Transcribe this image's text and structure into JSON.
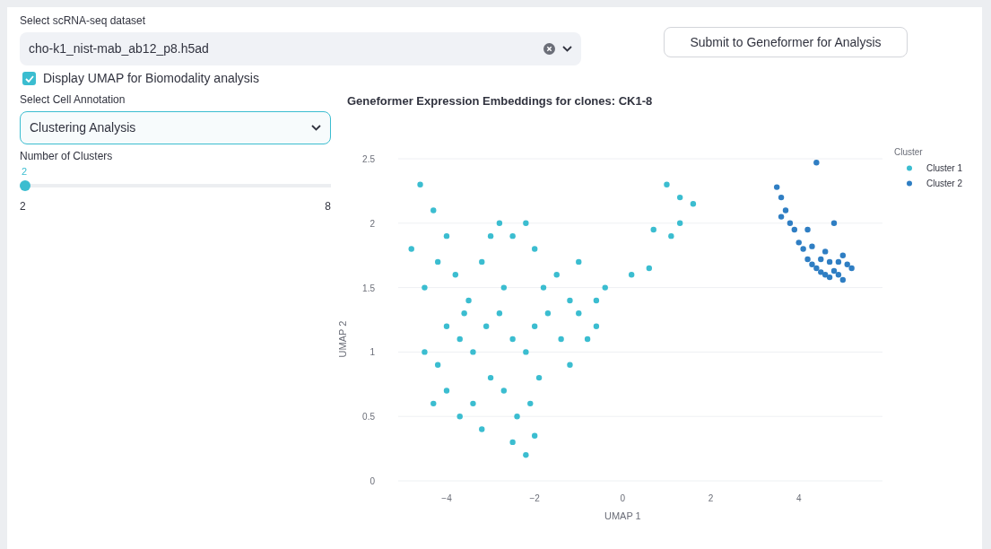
{
  "dataset": {
    "label": "Select scRNA-seq dataset",
    "value": "cho-k1_nist-mab_ab12_p8.h5ad"
  },
  "submit_button": "Submit to Geneformer for Analysis",
  "umap_checkbox": {
    "label": "Display UMAP for Biomodality analysis",
    "checked": true
  },
  "annotation": {
    "label": "Select Cell Annotation",
    "value": "Clustering Analysis"
  },
  "clusters_slider": {
    "label": "Number of Clusters",
    "reading": "2",
    "min_label": "2",
    "max_label": "8",
    "level": 0
  },
  "chart": {
    "chart_data": {
      "type": "scatter",
      "title": "Geneformer Expression Embeddings for clones:  CK1-8",
      "xlabel": "UMAP 1",
      "ylabel": "UMAP 2",
      "legend": {
        "title": "Cluster"
      },
      "grid": true,
      "xlim": [
        -5.1,
        5.9
      ],
      "ylim": [
        0,
        2.5
      ],
      "xticks": [
        {
          "value": -4,
          "label": "−4"
        },
        {
          "value": -2,
          "label": "−2"
        },
        0,
        2,
        4
      ],
      "yticks": [
        0,
        0.5,
        1,
        1.5,
        2,
        2.5
      ],
      "series": [
        {
          "name": "Cluster 1",
          "color": "#3bbdd0",
          "x": [
            -4.6,
            -4.3,
            -4.8,
            -4.5,
            -4.2,
            -4.0,
            -3.8,
            -3.5,
            -3.2,
            -3.0,
            -2.8,
            -2.5,
            -2.2,
            -2.0,
            -1.8,
            -1.5,
            -1.2,
            -1.0,
            -0.8,
            -0.6,
            -4.5,
            -4.2,
            -4.0,
            -3.7,
            -3.4,
            -3.1,
            -2.8,
            -2.5,
            -2.2,
            -2.0,
            -1.7,
            -1.4,
            -1.2,
            -4.3,
            -4.0,
            -3.7,
            -3.4,
            -3.0,
            -2.7,
            -2.4,
            -2.1,
            -1.9,
            -2.5,
            -2.2,
            -2.0,
            -3.2,
            -0.4,
            0.2,
            0.6,
            1.1,
            1.3,
            0.7,
            1.0,
            1.3,
            1.6,
            -2.7,
            -3.6,
            -1.0,
            -0.6
          ],
          "values": [
            2.3,
            2.1,
            1.8,
            1.5,
            1.7,
            1.9,
            1.6,
            1.4,
            1.7,
            1.9,
            2.0,
            1.9,
            2.0,
            1.8,
            1.5,
            1.6,
            1.4,
            1.3,
            1.1,
            1.2,
            1.0,
            0.9,
            1.2,
            1.1,
            1.0,
            1.2,
            1.3,
            1.1,
            1.0,
            1.2,
            1.3,
            1.1,
            0.9,
            0.6,
            0.7,
            0.5,
            0.6,
            0.8,
            0.7,
            0.5,
            0.6,
            0.8,
            0.3,
            0.2,
            0.35,
            0.4,
            1.5,
            1.6,
            1.65,
            1.9,
            2.0,
            1.95,
            2.3,
            2.2,
            2.15,
            1.5,
            1.3,
            1.7,
            1.4
          ]
        },
        {
          "name": "Cluster 2",
          "color": "#2f7ec3",
          "x": [
            3.5,
            3.6,
            3.7,
            3.8,
            3.9,
            4.0,
            4.1,
            4.2,
            4.3,
            4.4,
            4.5,
            4.6,
            4.7,
            4.8,
            4.9,
            5.0,
            5.1,
            5.2,
            4.5,
            4.7,
            4.9,
            4.4,
            4.8,
            3.6,
            4.2,
            5.0,
            4.6,
            4.3
          ],
          "values": [
            2.28,
            2.2,
            2.1,
            2.0,
            1.95,
            1.85,
            1.8,
            1.72,
            1.68,
            1.65,
            1.62,
            1.6,
            1.58,
            1.63,
            1.7,
            1.75,
            1.68,
            1.65,
            1.72,
            1.7,
            1.6,
            2.47,
            2.0,
            2.05,
            1.95,
            1.56,
            1.78,
            1.82
          ]
        }
      ]
    }
  }
}
